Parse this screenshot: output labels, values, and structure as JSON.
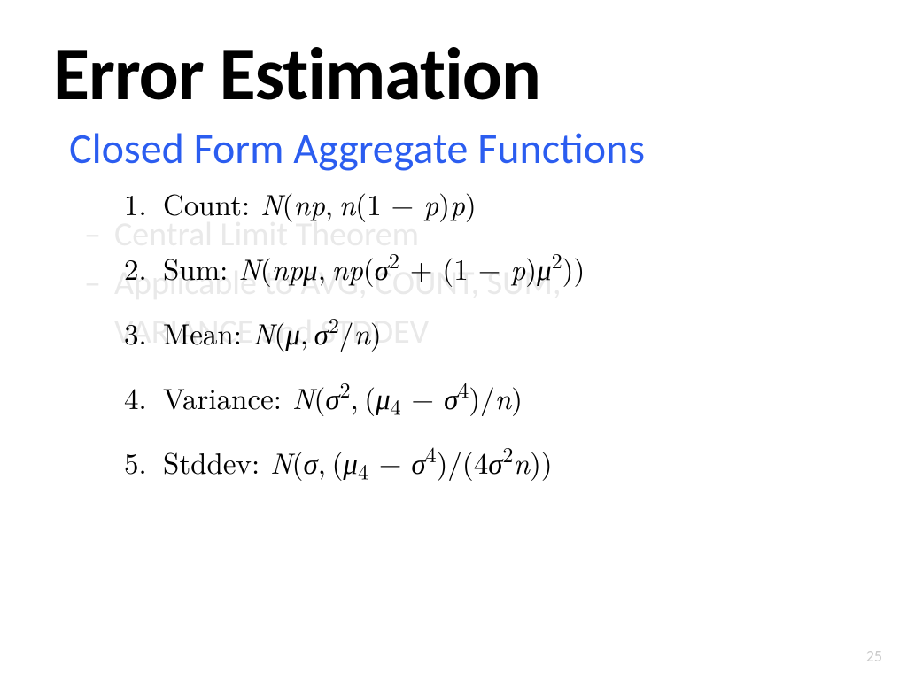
{
  "title": "Error Estimation",
  "subtitle": "Closed Form Aggregate Functions",
  "ghost": {
    "line1": "Central Limit Theorem",
    "line2a": "Applicable to AVG, COUNT, SUM,",
    "line2b": "VARIANCE and STDDEV"
  },
  "formulas": [
    {
      "num": "1.",
      "label": "Count:",
      "expr_html": "<span class='math'>N<span class='rm'>(</span>np<span class='rm'>,&#8201;</span>n<span class='rm'>(1 &minus; </span>p<span class='rm'>)</span>p<span class='rm'>)</span></span>"
    },
    {
      "num": "2.",
      "label": "Sum:",
      "expr_html": "<span class='math'>N<span class='rm'>(</span>np&mu;<span class='rm'>,&#8201;</span>np<span class='rm'>(</span>&sigma;<sup><span class='rm'>2</span></sup> <span class='rm'>+ (1 &minus; </span>p<span class='rm'>)</span>&mu;<sup><span class='rm'>2</span></sup><span class='rm'>))</span></span>"
    },
    {
      "num": "3.",
      "label": "Mean:",
      "expr_html": "<span class='math'>N<span class='rm'>(</span>&mu;<span class='rm'>,&#8201;</span>&sigma;<sup><span class='rm'>2</span></sup><span class='rm'>/</span>n<span class='rm'>)</span></span>"
    },
    {
      "num": "4.",
      "label": "Variance:",
      "expr_html": "<span class='math'>N<span class='rm'>(</span>&sigma;<sup><span class='rm'>2</span></sup><span class='rm'>,&#8201;(</span>&mu;<sub><span class='rm'>4</span></sub> <span class='rm'>&minus; </span>&sigma;<sup><span class='rm'>4</span></sup><span class='rm'>)/</span>n<span class='rm'>)</span></span>"
    },
    {
      "num": "5.",
      "label": "Stddev:",
      "expr_html": "<span class='math'>N<span class='rm'>(</span>&sigma;<span class='rm'>,&#8201;(</span>&mu;<sub><span class='rm'>4</span></sub> <span class='rm'>&minus; </span>&sigma;<sup><span class='rm'>4</span></sup><span class='rm'>)/(4</span>&sigma;<sup><span class='rm'>2</span></sup>n<span class='rm'>))</span></span>"
    }
  ],
  "page_number": "25"
}
